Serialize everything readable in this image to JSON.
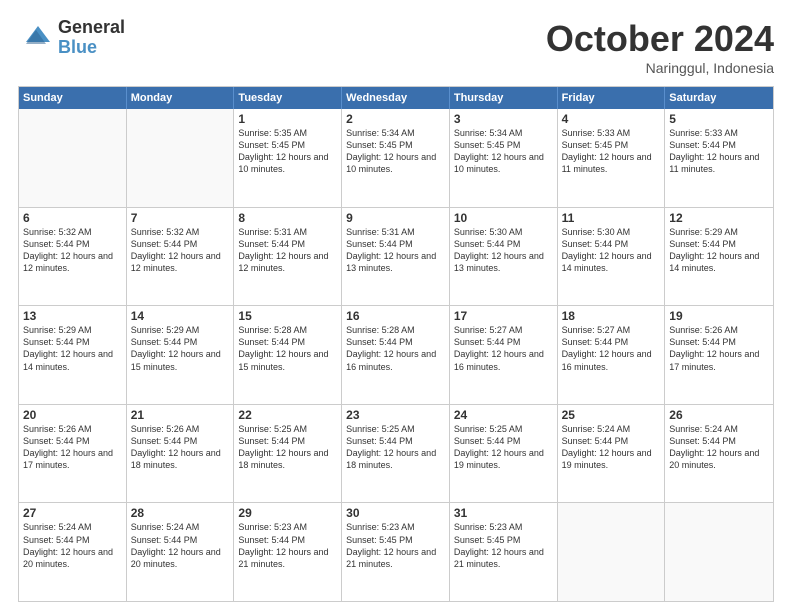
{
  "header": {
    "logo_general": "General",
    "logo_blue": "Blue",
    "month_title": "October 2024",
    "location": "Naringgul, Indonesia"
  },
  "weekdays": [
    "Sunday",
    "Monday",
    "Tuesday",
    "Wednesday",
    "Thursday",
    "Friday",
    "Saturday"
  ],
  "rows": [
    [
      {
        "day": "",
        "sunrise": "",
        "sunset": "",
        "daylight": "",
        "empty": true
      },
      {
        "day": "",
        "sunrise": "",
        "sunset": "",
        "daylight": "",
        "empty": true
      },
      {
        "day": "1",
        "sunrise": "Sunrise: 5:35 AM",
        "sunset": "Sunset: 5:45 PM",
        "daylight": "Daylight: 12 hours and 10 minutes.",
        "empty": false
      },
      {
        "day": "2",
        "sunrise": "Sunrise: 5:34 AM",
        "sunset": "Sunset: 5:45 PM",
        "daylight": "Daylight: 12 hours and 10 minutes.",
        "empty": false
      },
      {
        "day": "3",
        "sunrise": "Sunrise: 5:34 AM",
        "sunset": "Sunset: 5:45 PM",
        "daylight": "Daylight: 12 hours and 10 minutes.",
        "empty": false
      },
      {
        "day": "4",
        "sunrise": "Sunrise: 5:33 AM",
        "sunset": "Sunset: 5:45 PM",
        "daylight": "Daylight: 12 hours and 11 minutes.",
        "empty": false
      },
      {
        "day": "5",
        "sunrise": "Sunrise: 5:33 AM",
        "sunset": "Sunset: 5:44 PM",
        "daylight": "Daylight: 12 hours and 11 minutes.",
        "empty": false
      }
    ],
    [
      {
        "day": "6",
        "sunrise": "Sunrise: 5:32 AM",
        "sunset": "Sunset: 5:44 PM",
        "daylight": "Daylight: 12 hours and 12 minutes.",
        "empty": false
      },
      {
        "day": "7",
        "sunrise": "Sunrise: 5:32 AM",
        "sunset": "Sunset: 5:44 PM",
        "daylight": "Daylight: 12 hours and 12 minutes.",
        "empty": false
      },
      {
        "day": "8",
        "sunrise": "Sunrise: 5:31 AM",
        "sunset": "Sunset: 5:44 PM",
        "daylight": "Daylight: 12 hours and 12 minutes.",
        "empty": false
      },
      {
        "day": "9",
        "sunrise": "Sunrise: 5:31 AM",
        "sunset": "Sunset: 5:44 PM",
        "daylight": "Daylight: 12 hours and 13 minutes.",
        "empty": false
      },
      {
        "day": "10",
        "sunrise": "Sunrise: 5:30 AM",
        "sunset": "Sunset: 5:44 PM",
        "daylight": "Daylight: 12 hours and 13 minutes.",
        "empty": false
      },
      {
        "day": "11",
        "sunrise": "Sunrise: 5:30 AM",
        "sunset": "Sunset: 5:44 PM",
        "daylight": "Daylight: 12 hours and 14 minutes.",
        "empty": false
      },
      {
        "day": "12",
        "sunrise": "Sunrise: 5:29 AM",
        "sunset": "Sunset: 5:44 PM",
        "daylight": "Daylight: 12 hours and 14 minutes.",
        "empty": false
      }
    ],
    [
      {
        "day": "13",
        "sunrise": "Sunrise: 5:29 AM",
        "sunset": "Sunset: 5:44 PM",
        "daylight": "Daylight: 12 hours and 14 minutes.",
        "empty": false
      },
      {
        "day": "14",
        "sunrise": "Sunrise: 5:29 AM",
        "sunset": "Sunset: 5:44 PM",
        "daylight": "Daylight: 12 hours and 15 minutes.",
        "empty": false
      },
      {
        "day": "15",
        "sunrise": "Sunrise: 5:28 AM",
        "sunset": "Sunset: 5:44 PM",
        "daylight": "Daylight: 12 hours and 15 minutes.",
        "empty": false
      },
      {
        "day": "16",
        "sunrise": "Sunrise: 5:28 AM",
        "sunset": "Sunset: 5:44 PM",
        "daylight": "Daylight: 12 hours and 16 minutes.",
        "empty": false
      },
      {
        "day": "17",
        "sunrise": "Sunrise: 5:27 AM",
        "sunset": "Sunset: 5:44 PM",
        "daylight": "Daylight: 12 hours and 16 minutes.",
        "empty": false
      },
      {
        "day": "18",
        "sunrise": "Sunrise: 5:27 AM",
        "sunset": "Sunset: 5:44 PM",
        "daylight": "Daylight: 12 hours and 16 minutes.",
        "empty": false
      },
      {
        "day": "19",
        "sunrise": "Sunrise: 5:26 AM",
        "sunset": "Sunset: 5:44 PM",
        "daylight": "Daylight: 12 hours and 17 minutes.",
        "empty": false
      }
    ],
    [
      {
        "day": "20",
        "sunrise": "Sunrise: 5:26 AM",
        "sunset": "Sunset: 5:44 PM",
        "daylight": "Daylight: 12 hours and 17 minutes.",
        "empty": false
      },
      {
        "day": "21",
        "sunrise": "Sunrise: 5:26 AM",
        "sunset": "Sunset: 5:44 PM",
        "daylight": "Daylight: 12 hours and 18 minutes.",
        "empty": false
      },
      {
        "day": "22",
        "sunrise": "Sunrise: 5:25 AM",
        "sunset": "Sunset: 5:44 PM",
        "daylight": "Daylight: 12 hours and 18 minutes.",
        "empty": false
      },
      {
        "day": "23",
        "sunrise": "Sunrise: 5:25 AM",
        "sunset": "Sunset: 5:44 PM",
        "daylight": "Daylight: 12 hours and 18 minutes.",
        "empty": false
      },
      {
        "day": "24",
        "sunrise": "Sunrise: 5:25 AM",
        "sunset": "Sunset: 5:44 PM",
        "daylight": "Daylight: 12 hours and 19 minutes.",
        "empty": false
      },
      {
        "day": "25",
        "sunrise": "Sunrise: 5:24 AM",
        "sunset": "Sunset: 5:44 PM",
        "daylight": "Daylight: 12 hours and 19 minutes.",
        "empty": false
      },
      {
        "day": "26",
        "sunrise": "Sunrise: 5:24 AM",
        "sunset": "Sunset: 5:44 PM",
        "daylight": "Daylight: 12 hours and 20 minutes.",
        "empty": false
      }
    ],
    [
      {
        "day": "27",
        "sunrise": "Sunrise: 5:24 AM",
        "sunset": "Sunset: 5:44 PM",
        "daylight": "Daylight: 12 hours and 20 minutes.",
        "empty": false
      },
      {
        "day": "28",
        "sunrise": "Sunrise: 5:24 AM",
        "sunset": "Sunset: 5:44 PM",
        "daylight": "Daylight: 12 hours and 20 minutes.",
        "empty": false
      },
      {
        "day": "29",
        "sunrise": "Sunrise: 5:23 AM",
        "sunset": "Sunset: 5:44 PM",
        "daylight": "Daylight: 12 hours and 21 minutes.",
        "empty": false
      },
      {
        "day": "30",
        "sunrise": "Sunrise: 5:23 AM",
        "sunset": "Sunset: 5:45 PM",
        "daylight": "Daylight: 12 hours and 21 minutes.",
        "empty": false
      },
      {
        "day": "31",
        "sunrise": "Sunrise: 5:23 AM",
        "sunset": "Sunset: 5:45 PM",
        "daylight": "Daylight: 12 hours and 21 minutes.",
        "empty": false
      },
      {
        "day": "",
        "sunrise": "",
        "sunset": "",
        "daylight": "",
        "empty": true
      },
      {
        "day": "",
        "sunrise": "",
        "sunset": "",
        "daylight": "",
        "empty": true
      }
    ]
  ]
}
